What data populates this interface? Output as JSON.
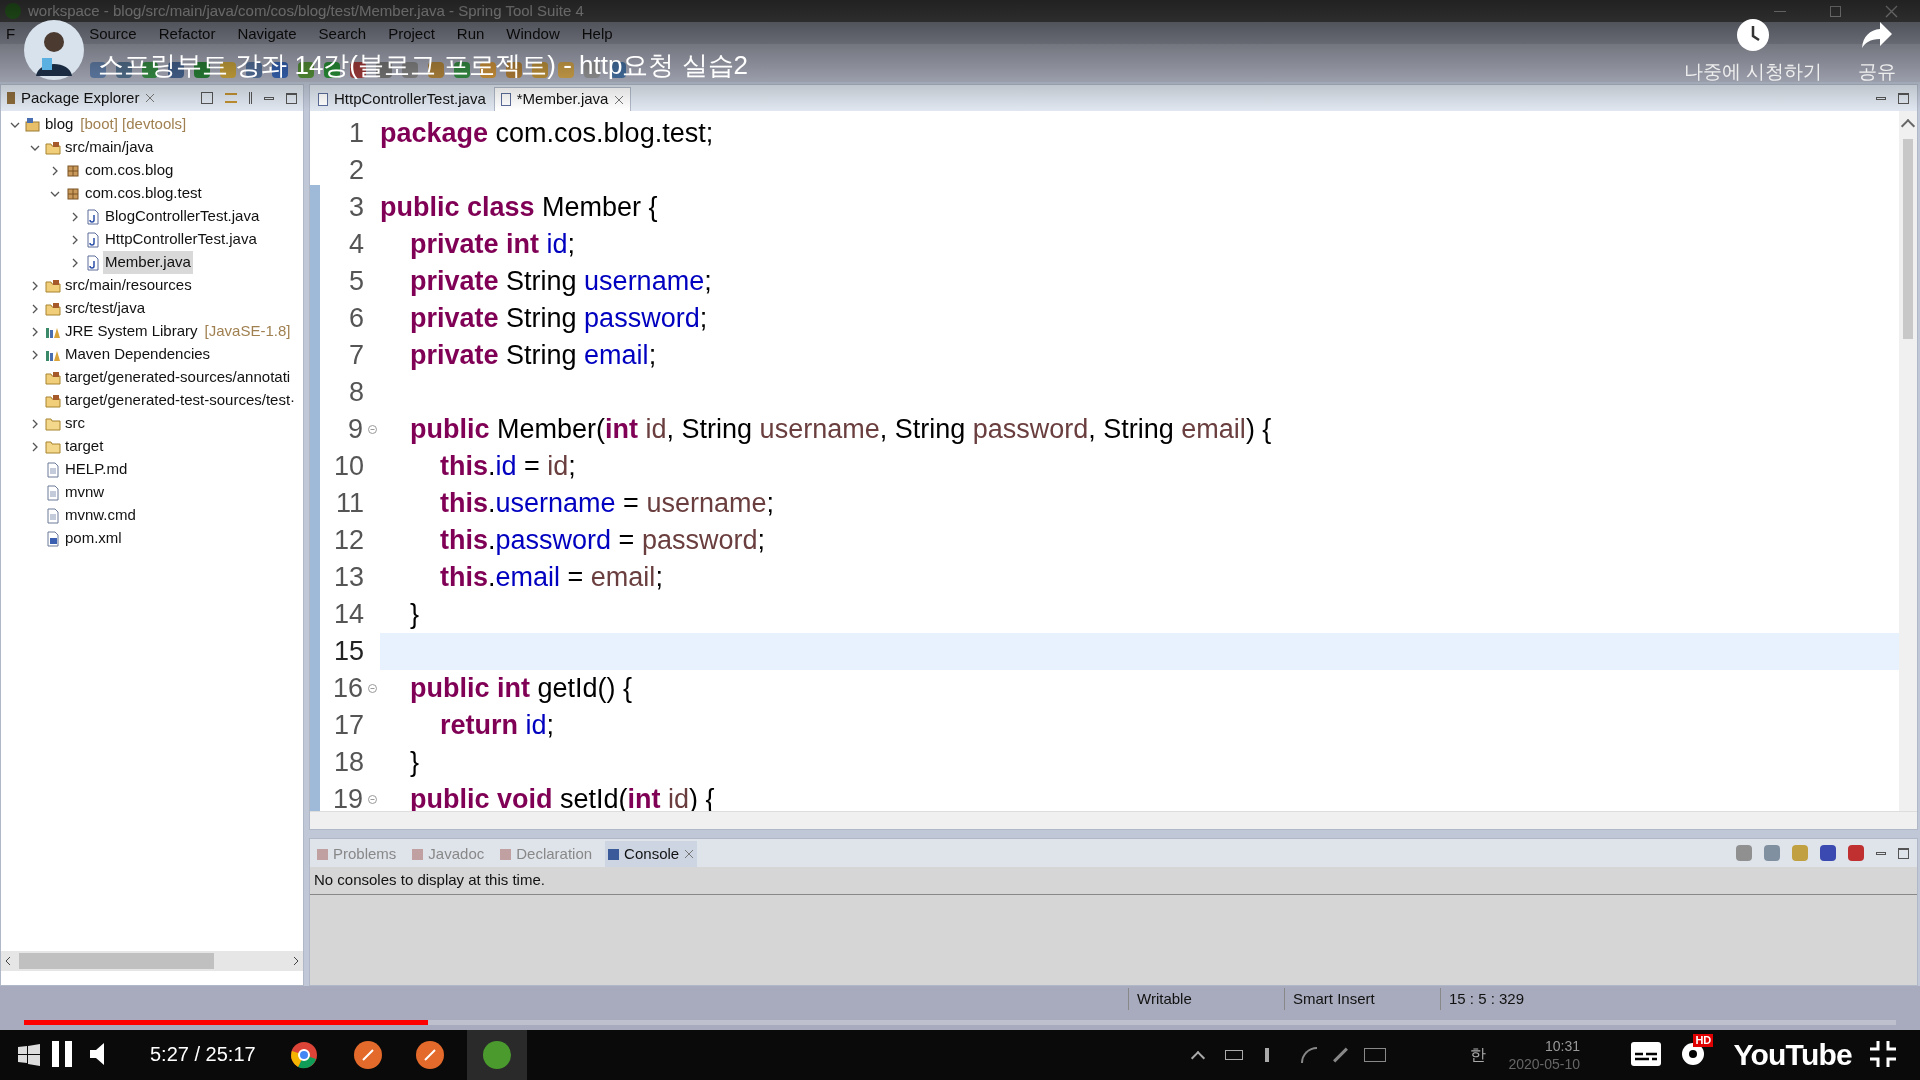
{
  "window": {
    "title": "workspace - blog/src/main/java/com/cos/blog/test/Member.java - Spring Tool Suite 4"
  },
  "menu": [
    "F",
    "Source",
    "Refactor",
    "Navigate",
    "Search",
    "Project",
    "Run",
    "Window",
    "Help"
  ],
  "explorer": {
    "title": "Package Explorer",
    "tree": [
      {
        "label": "blog",
        "decoration": "[boot] [devtools]",
        "kind": "project",
        "expanded": true,
        "selected": false,
        "children": [
          {
            "label": "src/main/java",
            "kind": "source-folder",
            "expanded": true,
            "selected": false,
            "children": [
              {
                "label": "com.cos.blog",
                "kind": "package",
                "expanded": false,
                "selected": false
              },
              {
                "label": "com.cos.blog.test",
                "kind": "package",
                "expanded": true,
                "selected": false,
                "children": [
                  {
                    "label": "BlogControllerTest.java",
                    "kind": "java-file",
                    "expanded": false,
                    "selected": false
                  },
                  {
                    "label": "HttpControllerTest.java",
                    "kind": "java-file",
                    "expanded": false,
                    "selected": false
                  },
                  {
                    "label": "Member.java",
                    "kind": "java-file",
                    "expanded": false,
                    "selected": true
                  }
                ]
              }
            ]
          },
          {
            "label": "src/main/resources",
            "kind": "source-folder",
            "expanded": false,
            "selected": false
          },
          {
            "label": "src/test/java",
            "kind": "source-folder",
            "expanded": false,
            "selected": false
          },
          {
            "label": "JRE System Library",
            "decoration": "[JavaSE-1.8]",
            "kind": "library",
            "expanded": false,
            "selected": false
          },
          {
            "label": "Maven Dependencies",
            "kind": "library",
            "expanded": false,
            "selected": false
          },
          {
            "label": "target/generated-sources/annotati",
            "kind": "source-folder",
            "selected": false
          },
          {
            "label": "target/generated-test-sources/test·",
            "kind": "source-folder",
            "selected": false
          },
          {
            "label": "src",
            "kind": "folder",
            "expanded": false,
            "selected": false
          },
          {
            "label": "target",
            "kind": "folder",
            "expanded": false,
            "selected": false
          },
          {
            "label": "HELP.md",
            "kind": "file",
            "selected": false
          },
          {
            "label": "mvnw",
            "kind": "file",
            "selected": false
          },
          {
            "label": "mvnw.cmd",
            "kind": "file",
            "selected": false
          },
          {
            "label": "pom.xml",
            "kind": "xml",
            "selected": false
          }
        ]
      }
    ]
  },
  "editor": {
    "tabs": [
      {
        "label": "HttpControllerTest.java",
        "selected": false
      },
      {
        "label": "*Member.java",
        "selected": true
      }
    ],
    "lines": [
      {
        "number": "1",
        "current": false,
        "fold": false,
        "tokens": [
          {
            "kind": "keyword",
            "text": "package"
          },
          {
            "kind": "plain",
            "text": " com.cos.blog.test;"
          }
        ]
      },
      {
        "number": "2",
        "current": false,
        "fold": false
      },
      {
        "number": "3",
        "current": false,
        "fold": false,
        "tokens": [
          {
            "kind": "keyword",
            "text": "public class"
          },
          {
            "kind": "plain",
            "text": " Member {"
          }
        ]
      },
      {
        "number": "4",
        "current": false,
        "fold": false,
        "tokens": [
          {
            "kind": "keyword",
            "text": "    private int"
          },
          {
            "kind": "field",
            "text": " id"
          },
          {
            "kind": "plain",
            "text": ";"
          }
        ]
      },
      {
        "number": "5",
        "current": false,
        "fold": false,
        "tokens": [
          {
            "kind": "keyword",
            "text": "    private"
          },
          {
            "kind": "plain",
            "text": " String"
          },
          {
            "kind": "field",
            "text": " username"
          },
          {
            "kind": "plain",
            "text": ";"
          }
        ]
      },
      {
        "number": "6",
        "current": false,
        "fold": false,
        "tokens": [
          {
            "kind": "keyword",
            "text": "    private"
          },
          {
            "kind": "plain",
            "text": " String"
          },
          {
            "kind": "field",
            "text": " password"
          },
          {
            "kind": "plain",
            "text": ";"
          }
        ]
      },
      {
        "number": "7",
        "current": false,
        "fold": false,
        "tokens": [
          {
            "kind": "keyword",
            "text": "    private"
          },
          {
            "kind": "plain",
            "text": " String"
          },
          {
            "kind": "field",
            "text": " email"
          },
          {
            "kind": "plain",
            "text": ";"
          }
        ]
      },
      {
        "number": "8",
        "current": false,
        "fold": false
      },
      {
        "number": "9",
        "current": false,
        "fold": true,
        "tokens": [
          {
            "kind": "keyword",
            "text": "    public"
          },
          {
            "kind": "plain",
            "text": " Member("
          },
          {
            "kind": "keyword",
            "text": "int"
          },
          {
            "kind": "param",
            "text": " id"
          },
          {
            "kind": "plain",
            "text": ", String"
          },
          {
            "kind": "param",
            "text": " username"
          },
          {
            "kind": "plain",
            "text": ", String"
          },
          {
            "kind": "param",
            "text": " password"
          },
          {
            "kind": "plain",
            "text": ", String"
          },
          {
            "kind": "param",
            "text": " email"
          },
          {
            "kind": "plain",
            "text": ") {"
          }
        ]
      },
      {
        "number": "10",
        "current": false,
        "fold": false,
        "tokens": [
          {
            "kind": "keyword",
            "text": "        this"
          },
          {
            "kind": "plain",
            "text": "."
          },
          {
            "kind": "field",
            "text": "id"
          },
          {
            "kind": "plain",
            "text": " ="
          },
          {
            "kind": "param",
            "text": " id"
          },
          {
            "kind": "plain",
            "text": ";"
          }
        ]
      },
      {
        "number": "11",
        "current": false,
        "fold": false,
        "tokens": [
          {
            "kind": "keyword",
            "text": "        this"
          },
          {
            "kind": "plain",
            "text": "."
          },
          {
            "kind": "field",
            "text": "username"
          },
          {
            "kind": "plain",
            "text": " ="
          },
          {
            "kind": "param",
            "text": " username"
          },
          {
            "kind": "plain",
            "text": ";"
          }
        ]
      },
      {
        "number": "12",
        "current": false,
        "fold": false,
        "tokens": [
          {
            "kind": "keyword",
            "text": "        this"
          },
          {
            "kind": "plain",
            "text": "."
          },
          {
            "kind": "field",
            "text": "password"
          },
          {
            "kind": "plain",
            "text": " ="
          },
          {
            "kind": "param",
            "text": " password"
          },
          {
            "kind": "plain",
            "text": ";"
          }
        ]
      },
      {
        "number": "13",
        "current": false,
        "fold": false,
        "tokens": [
          {
            "kind": "keyword",
            "text": "        this"
          },
          {
            "kind": "plain",
            "text": "."
          },
          {
            "kind": "field",
            "text": "email"
          },
          {
            "kind": "plain",
            "text": " ="
          },
          {
            "kind": "param",
            "text": " email"
          },
          {
            "kind": "plain",
            "text": ";"
          }
        ]
      },
      {
        "number": "14",
        "current": false,
        "fold": false,
        "tokens": [
          {
            "kind": "plain",
            "text": "    }"
          }
        ]
      },
      {
        "number": "15",
        "current": true,
        "fold": false
      },
      {
        "number": "16",
        "current": false,
        "fold": true,
        "tokens": [
          {
            "kind": "keyword",
            "text": "    public int"
          },
          {
            "kind": "plain",
            "text": " getId() {"
          }
        ]
      },
      {
        "number": "17",
        "current": false,
        "fold": false,
        "tokens": [
          {
            "kind": "keyword",
            "text": "        return"
          },
          {
            "kind": "field",
            "text": " id"
          },
          {
            "kind": "plain",
            "text": ";"
          }
        ]
      },
      {
        "number": "18",
        "current": false,
        "fold": false,
        "tokens": [
          {
            "kind": "plain",
            "text": "    }"
          }
        ]
      },
      {
        "number": "19",
        "current": false,
        "fold": true,
        "tokens": [
          {
            "kind": "keyword",
            "text": "    public void"
          },
          {
            "kind": "plain",
            "text": " setId("
          },
          {
            "kind": "keyword",
            "text": "int"
          },
          {
            "kind": "param",
            "text": " id"
          },
          {
            "kind": "plain",
            "text": ") {"
          }
        ]
      }
    ]
  },
  "bottom_panel": {
    "tabs": [
      {
        "label": "Problems",
        "selected": false
      },
      {
        "label": "Javadoc",
        "selected": false
      },
      {
        "label": "Declaration",
        "selected": false
      },
      {
        "label": "Console",
        "selected": true
      }
    ],
    "message": "No consoles to display at this time."
  },
  "status_bar": [
    "Writable",
    "Smart Insert",
    "15 : 5 : 329"
  ],
  "video": {
    "title": "스프링부트 강좌 14강(블로그 프로젝트) - http요청 실습2",
    "watch_later": "나중에 시청하기",
    "share": "공유",
    "time": "5:27 / 25:17",
    "level": 0.216,
    "quality": "HD",
    "logo": "YouTube"
  },
  "taskbar": {
    "ime": "한",
    "clock": "10:31",
    "date": "2020-05-10"
  }
}
